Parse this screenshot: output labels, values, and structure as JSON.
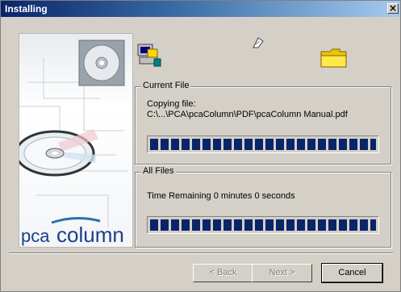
{
  "window": {
    "title": "Installing",
    "close_glyph": "×"
  },
  "art": {
    "brand_prefix": "pca",
    "brand_name": "column"
  },
  "icons": [
    "computer-install-icon",
    "flying-page-icon",
    "folder-icon"
  ],
  "current_file": {
    "legend": "Current File",
    "status": "Copying file:",
    "path": "C:\\...\\PCA\\pcaColumn\\PDF\\pcaColumn Manual.pdf",
    "progress_percent": 100
  },
  "all_files": {
    "legend": "All Files",
    "time_remaining": "Time Remaining 0 minutes 0 seconds",
    "progress_percent": 100
  },
  "buttons": {
    "back": "< Back",
    "next": "Next >",
    "cancel": "Cancel"
  },
  "colors": {
    "title_start": "#0a246a",
    "title_end": "#a6caf0",
    "progress": "#0a246a",
    "face": "#d4d0c8",
    "brand_blue": "#2a6fb0"
  }
}
